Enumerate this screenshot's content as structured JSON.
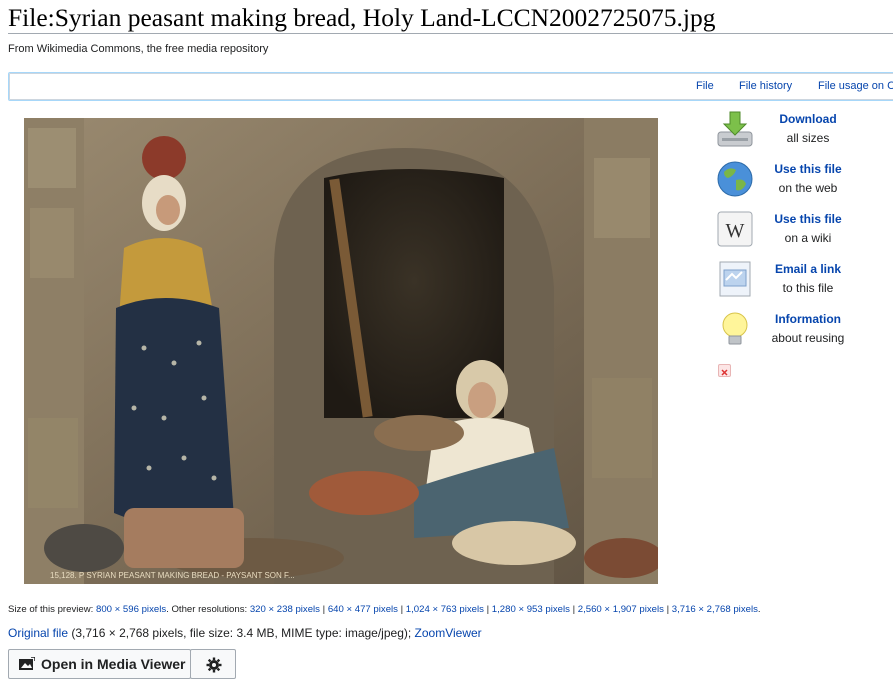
{
  "page": {
    "title": "File:Syrian peasant making bread, Holy Land-LCCN2002725075.jpg",
    "subtitle": "From Wikimedia Commons, the free media repository"
  },
  "tabs": [
    {
      "label": "File"
    },
    {
      "label": "File history"
    },
    {
      "label": "File usage on C"
    }
  ],
  "preview": {
    "caption_on_image": "15,128. P SYRIAN PEASANT MAKING BREAD - PAYSANT SON F..."
  },
  "reuse_panel": [
    {
      "line1": "Download",
      "line2": "all sizes",
      "icon": "download-icon"
    },
    {
      "line1": "Use this file",
      "line2": "on the web",
      "icon": "globe-icon"
    },
    {
      "line1": "Use this file",
      "line2": "on a wiki",
      "icon": "wikipedia-w-icon"
    },
    {
      "line1": "Email a link",
      "line2": "to this file",
      "icon": "email-icon"
    },
    {
      "line1": "Information",
      "line2": "about reusing",
      "icon": "lightbulb-icon"
    }
  ],
  "resolutions": {
    "prefix": "Size of this preview: ",
    "preview_size": "800 × 596 pixels",
    "other_label": ". Other resolutions: ",
    "sizes": [
      "320 × 238 pixels",
      "640 × 477 pixels",
      "1,024 × 763 pixels",
      "1,280 × 953 pixels",
      "2,560 × 1,907 pixels",
      "3,716 × 2,768 pixels"
    ]
  },
  "original": {
    "link": "Original file",
    "details": " (3,716 × 2,768 pixels, file size: 3.4 MB, MIME type: image/jpeg); ",
    "zoom_link": "ZoomViewer"
  },
  "buttons": {
    "media_viewer": "Open in Media Viewer"
  },
  "colors": {
    "link": "#0645ad",
    "tab_border": "#a7d7f9",
    "button_bg": "#f8f9fa"
  }
}
